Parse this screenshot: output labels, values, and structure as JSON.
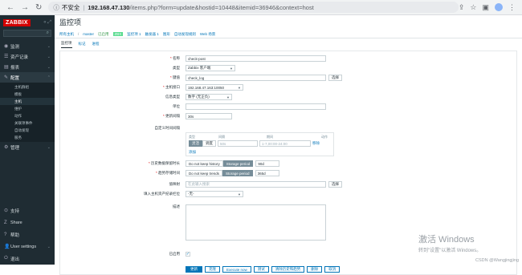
{
  "browser": {
    "security_label": "不安全",
    "url_host": "192.168.47.130",
    "url_path": "/items.php?form=update&hostid=10448&itemid=36946&context=host"
  },
  "sidebar": {
    "logo": "ZABBIX",
    "menu": [
      {
        "label": "监测",
        "icon": "eye-icon"
      },
      {
        "label": "资产记录",
        "icon": "list-icon"
      },
      {
        "label": "报表",
        "icon": "chart-icon"
      },
      {
        "label": "配置",
        "icon": "wrench-icon"
      }
    ],
    "submenu": [
      "主机群组",
      "模板",
      "主机",
      "维护",
      "动作",
      "关联项事件",
      "自动发现",
      "服务"
    ],
    "management": "管理",
    "bottom": [
      "支持",
      "Share",
      "帮助",
      "User settings",
      "退出"
    ]
  },
  "page": {
    "title": "监控项",
    "breadcrumbs": {
      "all_hosts": "所有主机",
      "sep": "/",
      "host": "master",
      "enabled": "已启用",
      "zbx": "ZBX",
      "items": "监控项 1",
      "triggers": "触发器 1",
      "graphs": "图形",
      "discovery": "自动发现规则",
      "web": "Web 场景"
    },
    "tabs": [
      "监控项",
      "标记",
      "进程"
    ]
  },
  "form": {
    "name_label": "名称",
    "name_value": "check-post",
    "type_label": "类型",
    "type_value": "Zabbix 客户端",
    "key_label": "键值",
    "key_value": "check_log",
    "key_select": "选择",
    "iface_label": "主机接口",
    "iface_value": "192.168.47.163:10050",
    "info_type_label": "信息类型",
    "info_type_value": "数字 (无正负)",
    "units_label": "单位",
    "units_value": "",
    "interval_label": "更新间隔",
    "interval_value": "30s",
    "custom_label": "自定义时间间隔",
    "custom": {
      "col_type": "类型",
      "col_interval": "间隔",
      "col_period": "期间",
      "col_action": "动作",
      "flexible": "灵活",
      "scheduling": "调度",
      "interval_value": "50s",
      "period_value": "1-7,00:00-24:00",
      "remove": "移除",
      "add": "添加"
    },
    "history_label": "历史数据保留时长",
    "history_opts": [
      "Do not keep history",
      "Storage period"
    ],
    "history_value": "90d",
    "trends_label": "趋势存储时间",
    "trends_opts": [
      "Do not keep trends",
      "Storage period"
    ],
    "trends_value": "365d",
    "app_label": "值映射",
    "app_placeholder": "在此输入搜索",
    "app_select": "选择",
    "inventory_label": "填入主机资产纪录栏位",
    "inventory_value": "-无-",
    "description_label": "描述",
    "enabled_label": "已启用",
    "enabled_checked": true,
    "buttons": {
      "update": "更新",
      "clone": "克隆",
      "execute": "Execute now",
      "test": "测试",
      "clear": "清除历史和趋势",
      "delete": "删除",
      "cancel": "取消"
    }
  },
  "overlay": {
    "activate_title": "激活 Windows",
    "activate_sub": "转到\"设置\"以激活 Windows。",
    "csdn": "CSDN @Wangjingjing"
  }
}
